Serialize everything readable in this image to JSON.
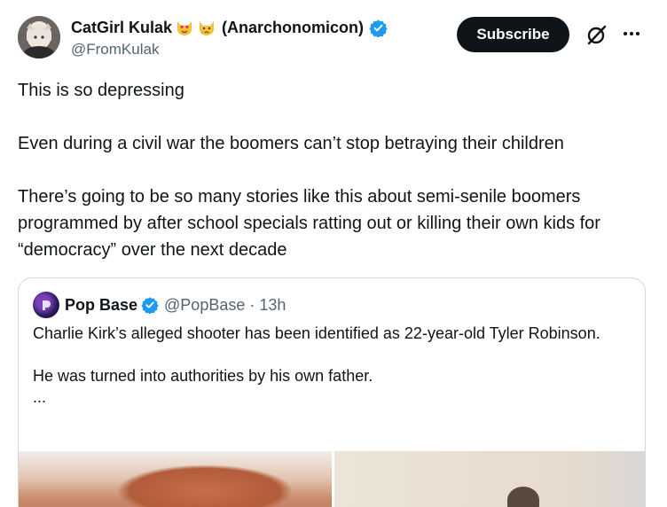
{
  "author": {
    "display_name": "CatGirl Kulak",
    "emojis": [
      "heart-eyes-cat-emoji",
      "crying-cat-emoji"
    ],
    "name_suffix": "(Anarchonomicon)",
    "handle": "@FromKulak",
    "verified": true
  },
  "actions": {
    "subscribe_label": "Subscribe",
    "grok_icon": "grok-icon",
    "more_icon": "more-icon"
  },
  "tweet": {
    "paragraphs": [
      "This is so depressing",
      "Even during a civil war the boomers can’t stop betraying their children",
      "There’s going to be so many stories like this about semi-senile boomers programmed by after school specials ratting out or killing their own kids for “democracy” over the next decade"
    ]
  },
  "quote": {
    "name": "Pop Base",
    "handle": "@PopBase",
    "time": "· 13h",
    "verified": true,
    "lines": [
      "Charlie Kirk’s alleged shooter has been identified as 22-year-old Tyler Robinson.",
      "He was turned into authorities by his own father.",
      "..."
    ]
  },
  "colors": {
    "text": "#0f1419",
    "secondary": "#536471",
    "verified_blue": "#1d9bf0",
    "border": "#cfd9de",
    "button_bg": "#0f1419"
  }
}
